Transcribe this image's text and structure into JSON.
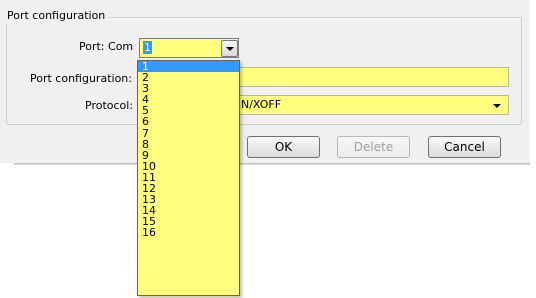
{
  "group": {
    "title": "Port configuration"
  },
  "port": {
    "label": "Port: Com",
    "value": "1"
  },
  "port_config": {
    "label": "Port configuration:",
    "value": ""
  },
  "protocol": {
    "label": "Protocol:",
    "value_visible": "N/XOFF"
  },
  "buttons": {
    "ok": "OK",
    "delete": "Delete",
    "cancel": "Cancel"
  },
  "dropdown": {
    "options": [
      "1",
      "2",
      "3",
      "4",
      "5",
      "6",
      "7",
      "8",
      "9",
      "10",
      "11",
      "12",
      "13",
      "14",
      "15",
      "16"
    ],
    "selected": "1"
  },
  "colors": {
    "field_bg": "#ffff80",
    "selection": "#3399ff",
    "dialog_bg": "#f0f0f0"
  }
}
